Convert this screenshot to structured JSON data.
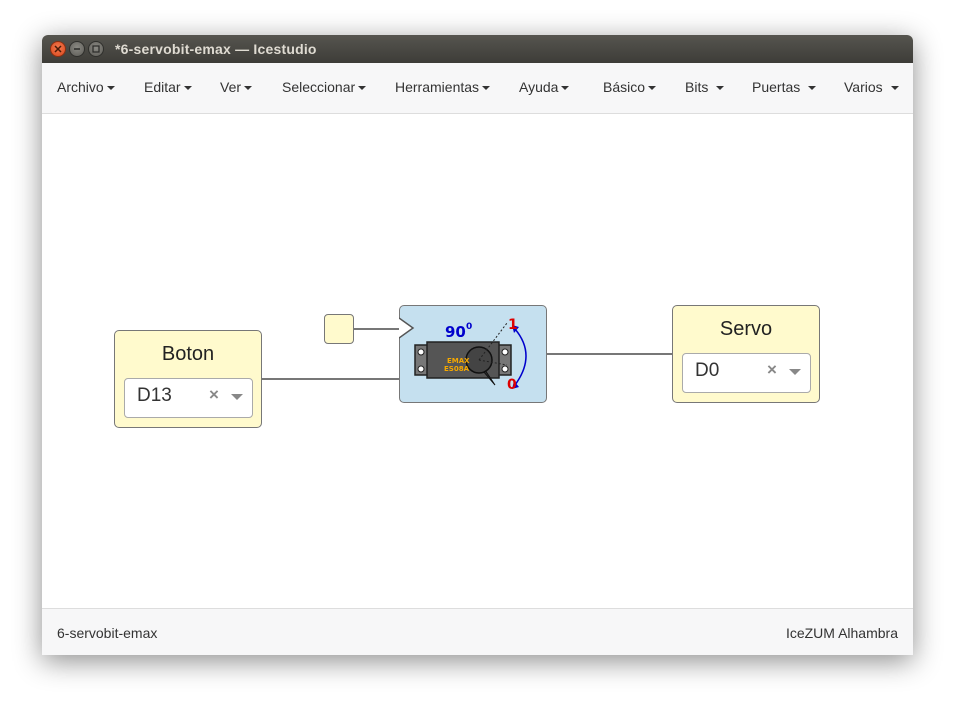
{
  "window": {
    "title": "*6-servobit-emax — Icestudio"
  },
  "menu": [
    {
      "label": "Archivo"
    },
    {
      "label": "Editar"
    },
    {
      "label": "Ver"
    },
    {
      "label": "Seleccionar"
    },
    {
      "label": "Herramientas"
    },
    {
      "label": "Ayuda"
    },
    {
      "label": "Básico"
    },
    {
      "label": "Bits"
    },
    {
      "label": "Puertas"
    },
    {
      "label": "Varios"
    }
  ],
  "canvas": {
    "input_block": {
      "title": "Boton",
      "pin": "D13",
      "clear_symbol": "×"
    },
    "servo_block": {
      "angle_label": "90",
      "angle_unit": "0",
      "high_label": "1",
      "low_label": "0",
      "brand_line1": "EMAX",
      "brand_line2": "ES08A"
    },
    "output_block": {
      "title": "Servo",
      "pin": "D0",
      "clear_symbol": "×"
    }
  },
  "status": {
    "project": "6-servobit-emax",
    "board": "IceZUM Alhambra"
  },
  "colors": {
    "io_block": "#fffacd",
    "servo_block": "#c5e0ef",
    "angle_text": "#0000cc",
    "level_text": "#dd0000",
    "wire": "#777777"
  }
}
